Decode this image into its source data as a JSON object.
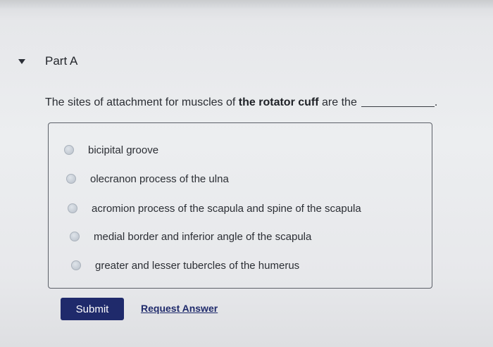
{
  "part": {
    "title": "Part A",
    "icon": "caret-down-icon"
  },
  "question": {
    "prefix": "The sites of attachment for muscles of",
    "emphasis": "the rotator cuff",
    "suffix": "are the",
    "end": "."
  },
  "options": [
    {
      "label": "bicipital groove"
    },
    {
      "label": "olecranon process of the ulna"
    },
    {
      "label": "acromion process of the scapula and spine of the scapula"
    },
    {
      "label": "medial border and inferior angle of the scapula"
    },
    {
      "label": "greater and lesser tubercles of the humerus"
    }
  ],
  "actions": {
    "submit_label": "Submit",
    "request_label": "Request Answer"
  },
  "colors": {
    "button": "#1f2a6b",
    "link": "#1f2a6b",
    "radio": "#b8c0ca"
  }
}
